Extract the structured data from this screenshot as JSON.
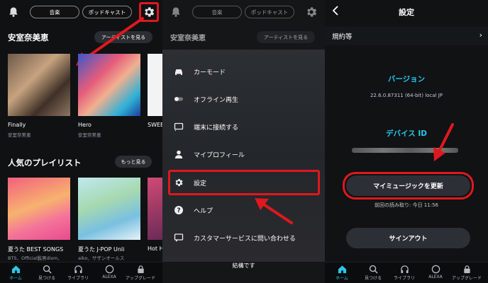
{
  "panel1": {
    "tabs": [
      "音楽",
      "ポッドキャスト"
    ],
    "artist_section": "安室奈美恵",
    "artist_button": "アーティストを見る",
    "albums": [
      {
        "title": "Finally",
        "artist": "安室奈美恵"
      },
      {
        "title": "Hero",
        "artist": "安室奈美恵"
      },
      {
        "title": "SWEE",
        "artist": ""
      }
    ],
    "playlist_section": "人気のプレイリスト",
    "more_button": "もっと見る",
    "playlists": [
      {
        "title": "夏うた BEST SONGS",
        "artist": "BTS、Official髭男dism、"
      },
      {
        "title": "夏うた J-POP Unli",
        "artist": "aiko、サザンオールス"
      },
      {
        "title": "Hot H",
        "artist": ""
      }
    ],
    "nav": [
      "ホーム",
      "見つける",
      "ライブラリ",
      "ALEXA",
      "アップグレード"
    ]
  },
  "panel2": {
    "tabs": [
      "音楽",
      "ポッドキャスト"
    ],
    "artist_section": "安室奈美恵",
    "artist_button": "アーティストを見る",
    "menu": [
      "カーモード",
      "オフライン再生",
      "端末に接続する",
      "マイプロフィール",
      "設定",
      "ヘルプ",
      "カスタマーサービスに問い合わせる"
    ],
    "close": "結構です"
  },
  "panel3": {
    "title": "設定",
    "terms": "規約等",
    "version_heading": "バージョン",
    "version_value": "22.6.0.87311 (64-bit) local JP",
    "device_heading": "デバイス ID",
    "refresh_button": "マイミュージックを更新",
    "last_read": "前回の読み取り: 今日 11:56",
    "signout_button": "サインアウト",
    "nav": [
      "ホーム",
      "見つける",
      "ライブラリ",
      "ALEXA",
      "アップグレード"
    ]
  },
  "colors": {
    "accent": "#29c6e8",
    "highlight": "#e0181e",
    "background": "#0f1113"
  }
}
